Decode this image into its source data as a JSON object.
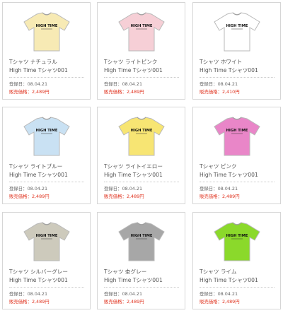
{
  "brand_text": "HIGH TIME",
  "date_label": "登録日：",
  "price_label": "販売価格：",
  "products": [
    {
      "name": "Tシャツ ナチュラル",
      "subname": "High Time Tシャツ001",
      "date": "08.04.21",
      "price": "2,489円",
      "color": "#f7eab4",
      "icon": "tshirt-icon"
    },
    {
      "name": "Tシャツ ライトピンク",
      "subname": "High Time Tシャツ001",
      "date": "08.04.21",
      "price": "2,489円",
      "color": "#f6cfd6",
      "icon": "tshirt-icon"
    },
    {
      "name": "Tシャツ ホワイト",
      "subname": "High Time Tシャツ001",
      "date": "08.04.21",
      "price": "2,410円",
      "color": "#ffffff",
      "icon": "tshirt-icon"
    },
    {
      "name": "Tシャツ ライトブルー",
      "subname": "High Time Tシャツ001",
      "date": "08.04.21",
      "price": "2,489円",
      "color": "#c9e1f3",
      "icon": "tshirt-icon"
    },
    {
      "name": "Tシャツ ライトイエロー",
      "subname": "High Time Tシャツ001",
      "date": "08.04.21",
      "price": "2,489円",
      "color": "#f7e573",
      "icon": "tshirt-icon"
    },
    {
      "name": "Tシャツ ピンク",
      "subname": "High Time Tシャツ001",
      "date": "08.04.21",
      "price": "2,489円",
      "color": "#e986c8",
      "icon": "tshirt-icon"
    },
    {
      "name": "Tシャツ シルバーグレー",
      "subname": "High Time Tシャツ001",
      "date": "08.04.21",
      "price": "2,489円",
      "color": "#cdcabc",
      "icon": "tshirt-icon"
    },
    {
      "name": "Tシャツ 杢グレー",
      "subname": "High Time Tシャツ001",
      "date": "08.04.21",
      "price": "2,489円",
      "color": "#a7a7a7",
      "icon": "tshirt-icon"
    },
    {
      "name": "Tシャツ ライム",
      "subname": "High Time Tシャツ001",
      "date": "08.04.21",
      "price": "2,489円",
      "color": "#8bd92b",
      "icon": "tshirt-icon"
    }
  ]
}
